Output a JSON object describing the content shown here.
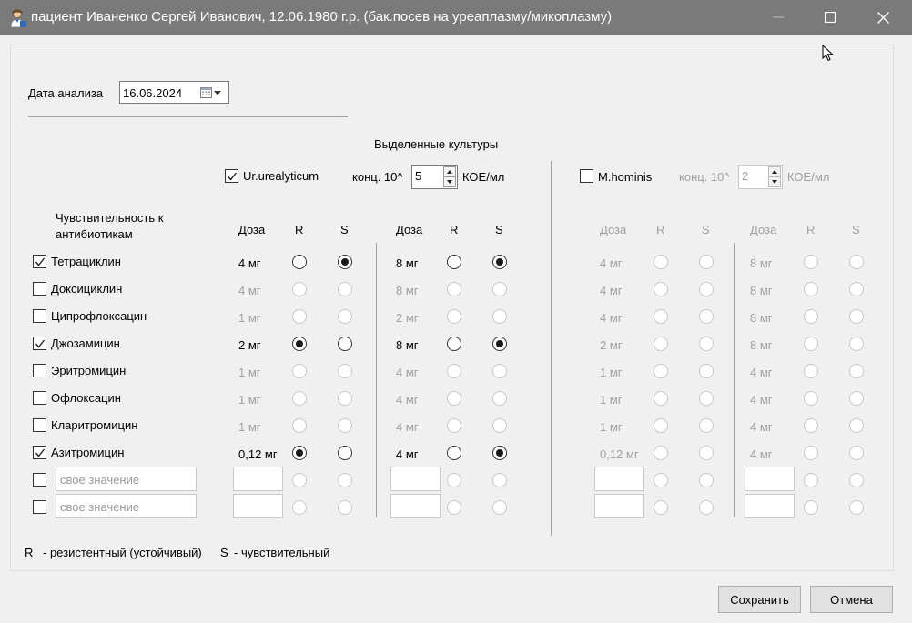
{
  "window": {
    "title": "пациент Иваненко Сергей Иванович, 12.06.1980 г.р. (бак.посев на уреаплазму/микоплазму)",
    "icon": "doctor-icon"
  },
  "date": {
    "label": "Дата анализа",
    "value": "16.06.2024",
    "icon": "calendar-icon"
  },
  "cultures": {
    "header": "Выделенные культуры",
    "conc_label": "конц. 10^",
    "unit": "КОЕ/мл",
    "culture1": {
      "name": "Ur.urealyticum",
      "checked": true,
      "conc": "5"
    },
    "culture2": {
      "name": "M.hominis",
      "checked": false,
      "conc": "2"
    }
  },
  "table": {
    "sens_header": "Чувствительность к антибиотикам",
    "col_dose": "Доза",
    "col_r": "R",
    "col_s": "S",
    "custom_placeholder": "свое значение",
    "rows": [
      {
        "name": "Тетрациклин",
        "checked": true,
        "d1": "4 мг",
        "v1": "S",
        "d2": "8 мг",
        "v2": "S",
        "d3": "4 мг",
        "d4": "8 мг"
      },
      {
        "name": "Доксициклин",
        "checked": false,
        "d1": "4 мг",
        "v1": "",
        "d2": "8 мг",
        "v2": "",
        "d3": "4 мг",
        "d4": "8 мг"
      },
      {
        "name": "Ципрофлоксацин",
        "checked": false,
        "d1": "1 мг",
        "v1": "",
        "d2": "2 мг",
        "v2": "",
        "d3": "4 мг",
        "d4": "8 мг"
      },
      {
        "name": "Джозамицин",
        "checked": true,
        "d1": "2 мг",
        "v1": "R",
        "d2": "8 мг",
        "v2": "S",
        "d3": "2 мг",
        "d4": "8 мг"
      },
      {
        "name": "Эритромицин",
        "checked": false,
        "d1": "1 мг",
        "v1": "",
        "d2": "4 мг",
        "v2": "",
        "d3": "1 мг",
        "d4": "4 мг"
      },
      {
        "name": "Офлоксацин",
        "checked": false,
        "d1": "1 мг",
        "v1": "",
        "d2": "4 мг",
        "v2": "",
        "d3": "1 мг",
        "d4": "4 мг"
      },
      {
        "name": "Кларитромицин",
        "checked": false,
        "d1": "1 мг",
        "v1": "",
        "d2": "4 мг",
        "v2": "",
        "d3": "1 мг",
        "d4": "4 мг"
      },
      {
        "name": "Азитромицин",
        "checked": true,
        "d1": "0,12 мг",
        "v1": "R",
        "d2": "4 мг",
        "v2": "S",
        "d3": "0,12 мг",
        "d4": "4 мг"
      }
    ]
  },
  "legend": {
    "r_key": "R",
    "r_text": "- резистентный (устойчивый)",
    "s_key": "S",
    "s_text": "- чувствительный"
  },
  "buttons": {
    "save": "Сохранить",
    "cancel": "Отмена"
  }
}
